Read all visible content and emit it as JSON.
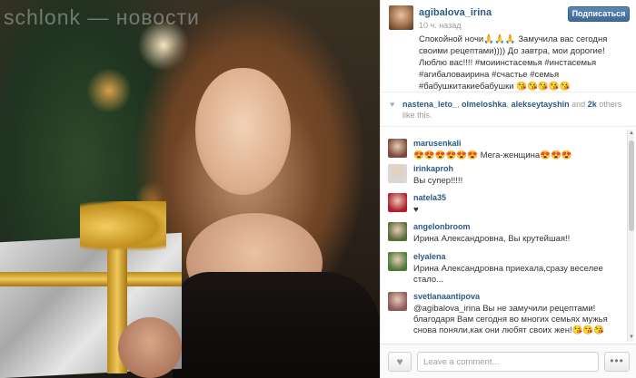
{
  "photo": {
    "watermark": "schlonk — новости"
  },
  "post": {
    "author": "agibalova_irina",
    "time_ago": "10 ч. назад",
    "follow_label": "Подписаться",
    "caption": "Спокойной ночи🙏🙏🙏 Замучила вас сегодня своими рецептами)))) До завтра, мои дорогие! Люблю вас!!!! #моиинстасемья #инстасемья #агибаловаирина #счастье #семья #бабушкитакиебабушки 😘😘😘😘😘"
  },
  "likes": {
    "users": [
      "nastena_leto_",
      "olmeloshka",
      "alekseytayshin"
    ],
    "and_label": "and",
    "count_label": "2k",
    "suffix": "others like this."
  },
  "comments": [
    {
      "user": "marusenkali",
      "text": "😍😍😍😍😍😍 Мега-женщина😍😍😍",
      "avatar_color": "#7a4a3a"
    },
    {
      "user": "irinkaproh",
      "text": "Вы супер!!!!!",
      "avatar_color": "#d8d8d8"
    },
    {
      "user": "natela35",
      "text": "♥",
      "avatar_color": "#b01e2e"
    },
    {
      "user": "angelonbroom",
      "text": "Ирина Александровна, Вы крутейшая!!",
      "avatar_color": "#5a6b3a"
    },
    {
      "user": "elyalena",
      "text": "Ирина Александровна приехала,сразу веселее стало...",
      "avatar_color": "#4d7a3a"
    },
    {
      "user": "svetlanaantipova",
      "text": "@agibalova_irina Вы не замучили рецептами! благодаря Вам сегодня во многих семьях мужья снова поняли,как они любят своих жен!😘😘😘",
      "avatar_color": "#8a5a5a"
    }
  ],
  "footer": {
    "comment_placeholder": "Leave a comment...",
    "more_label": "•••"
  },
  "colors": {
    "link": "#2b5a87",
    "follow_button": "#3e6a99"
  },
  "icons": {
    "like": "heart-icon",
    "more": "ellipsis-icon"
  }
}
